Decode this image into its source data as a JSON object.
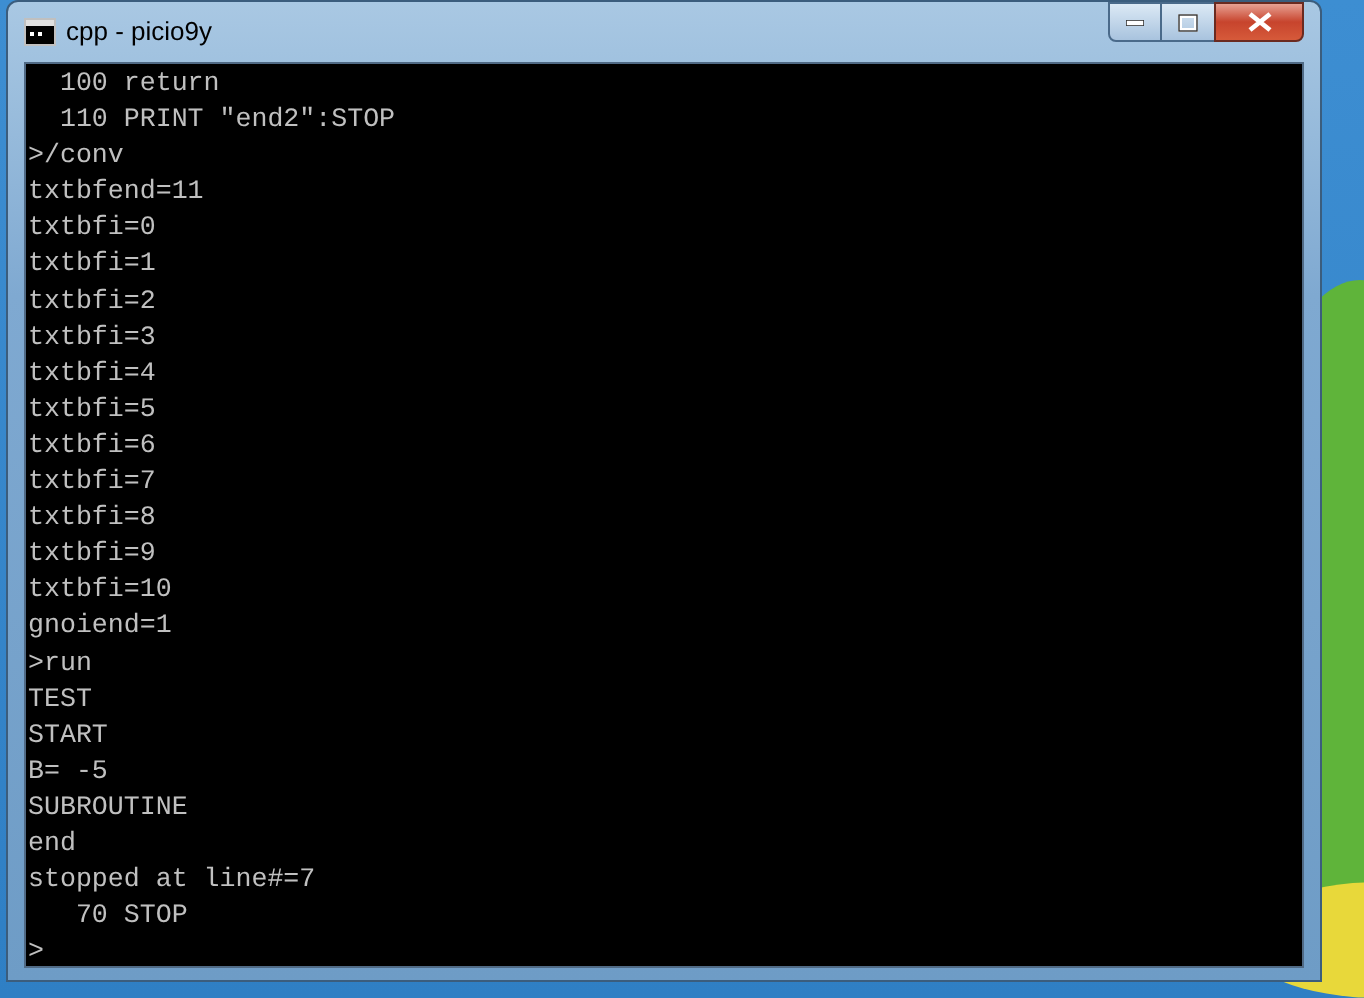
{
  "window": {
    "title": "cpp - picio9y"
  },
  "console": {
    "lines": [
      "  100 return",
      "  110 PRINT \"end2\":STOP",
      ">/conv",
      "txtbfend=11",
      "txtbfi=0",
      "txtbfi=1",
      "txtbfi=2",
      "txtbfi=3",
      "txtbfi=4",
      "txtbfi=5",
      "txtbfi=6",
      "txtbfi=7",
      "txtbfi=8",
      "txtbfi=9",
      "txtbfi=10",
      "gnoiend=1",
      ">run",
      "TEST",
      "START",
      "B= -5",
      "SUBROUTINE",
      "end",
      "stopped at line#=7",
      "   70 STOP",
      ">"
    ]
  }
}
